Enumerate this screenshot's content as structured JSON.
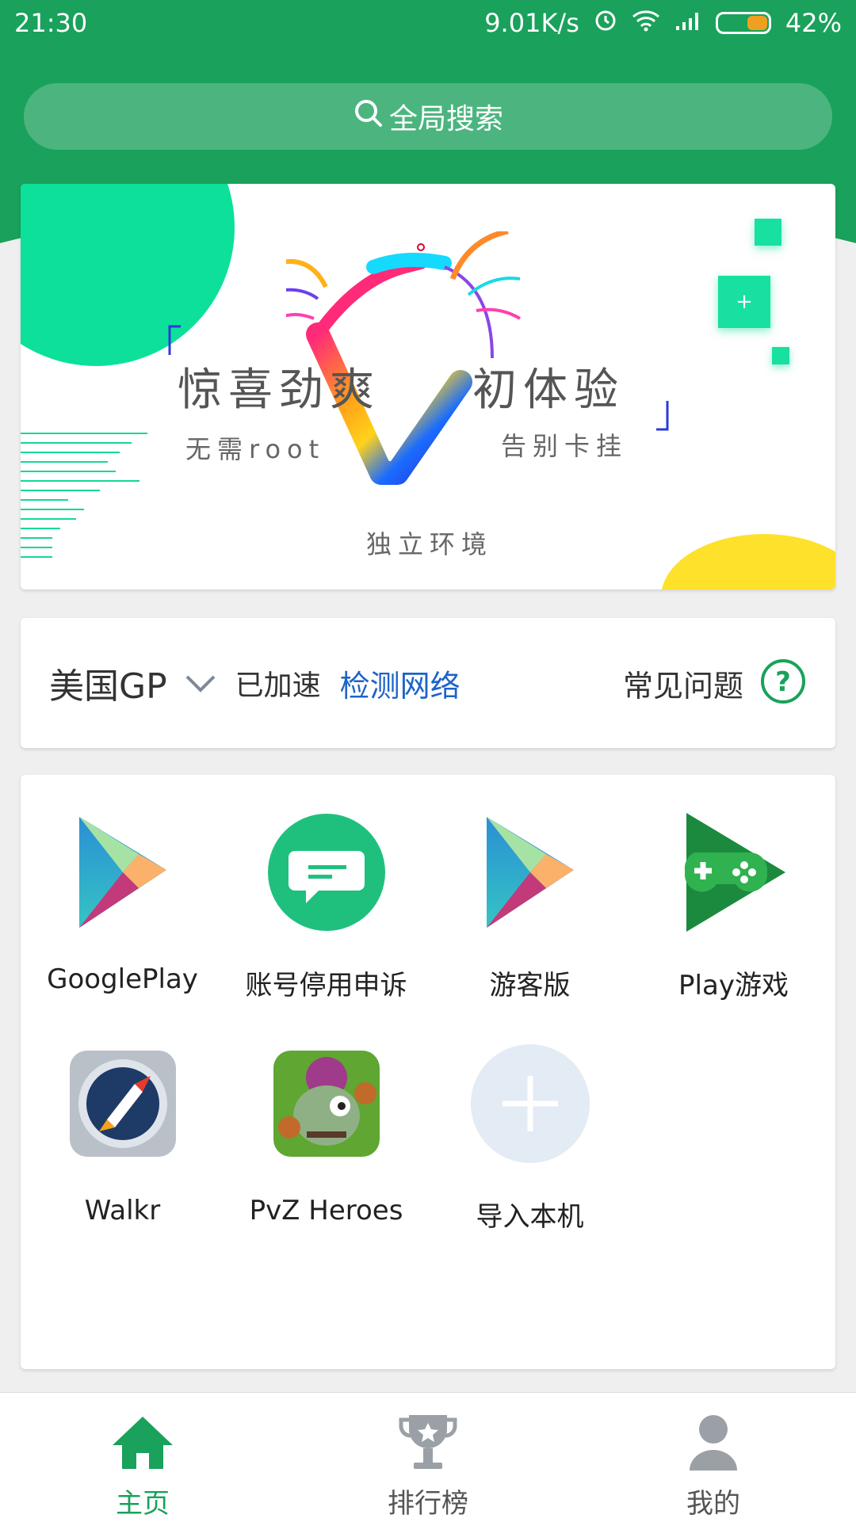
{
  "status_bar": {
    "time": "21:30",
    "speed": "9.01K/s",
    "battery": "42%",
    "battery_level": 0.42,
    "icons": [
      "alarm-icon",
      "wifi-icon",
      "signal-icon",
      "battery-icon"
    ]
  },
  "search": {
    "label": "全局搜索",
    "icon": "search-icon"
  },
  "banner": {
    "headline_left": "惊喜劲爽",
    "headline_right": "初体验",
    "tag_left": "无需root",
    "tag_right": "告别卡挂",
    "tag_bottom": "独立环境",
    "plus_symbol": "+",
    "colors": {
      "green": "#0de09a",
      "yellow": "#fde12a"
    }
  },
  "network": {
    "region": "美国GP",
    "status": "已加速",
    "check_network": "检测网络",
    "faq": "常见问题",
    "help_symbol": "?"
  },
  "apps": [
    {
      "label": "GooglePlay",
      "icon": "google-play-icon"
    },
    {
      "label": "账号停用申诉",
      "icon": "chat-appeal-icon"
    },
    {
      "label": "游客版",
      "icon": "google-play-icon"
    },
    {
      "label": "Play游戏",
      "icon": "play-games-icon"
    },
    {
      "label": "Walkr",
      "icon": "walkr-rocket-icon"
    },
    {
      "label": "PvZ Heroes",
      "icon": "pvz-heroes-icon"
    },
    {
      "label": "导入本机",
      "icon": "plus-icon"
    }
  ],
  "tabs": [
    {
      "label": "主页",
      "icon": "home-icon",
      "active": true
    },
    {
      "label": "排行榜",
      "icon": "trophy-icon",
      "active": false
    },
    {
      "label": "我的",
      "icon": "user-icon",
      "active": false
    }
  ],
  "theme": {
    "primary": "#1aa15b",
    "link": "#1e63c8",
    "inactive": "#9aa0a6"
  }
}
